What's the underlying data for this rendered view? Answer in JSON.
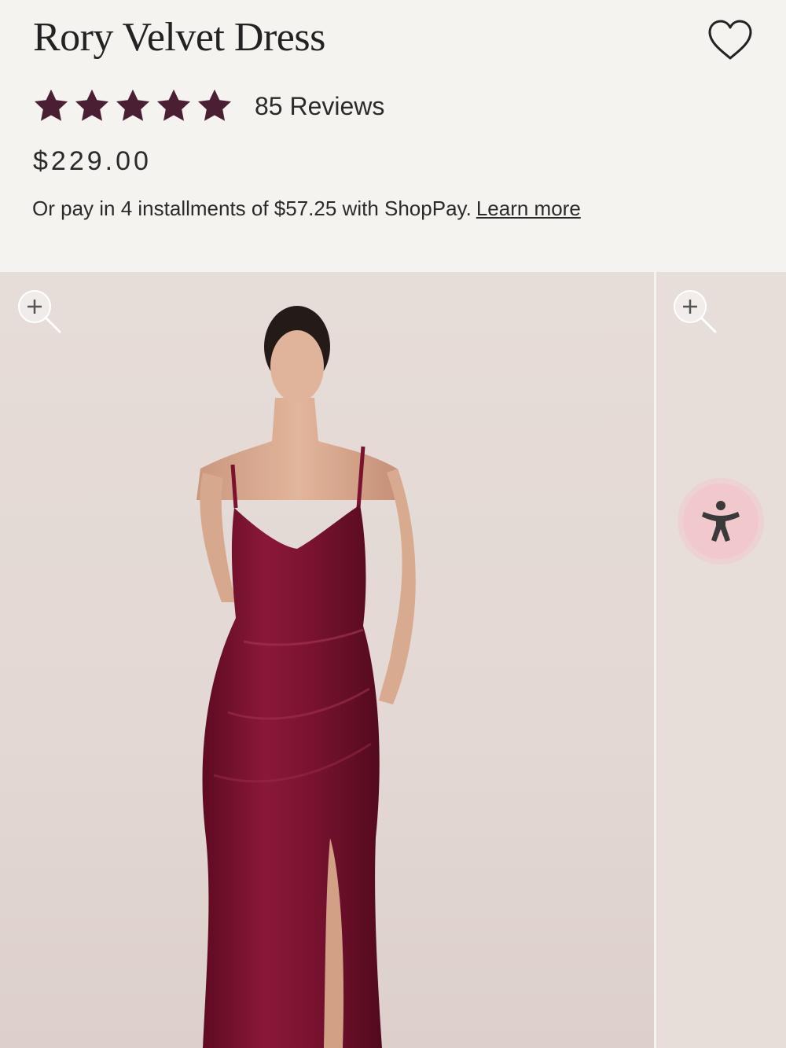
{
  "product": {
    "title": "Rory Velvet Dress",
    "rating": 5,
    "reviews_label": "85 Reviews",
    "price": "$229.00",
    "installments_text": "Or pay in 4 installments of $57.25 with ShopPay.",
    "learn_more": "Learn more"
  },
  "colors": {
    "star": "#4a1f33",
    "dress": "#7a1330",
    "background": "#f5f3f0"
  },
  "icons": {
    "wishlist": "heart-outline-icon",
    "zoom": "zoom-in-icon",
    "accessibility": "accessibility-icon"
  }
}
